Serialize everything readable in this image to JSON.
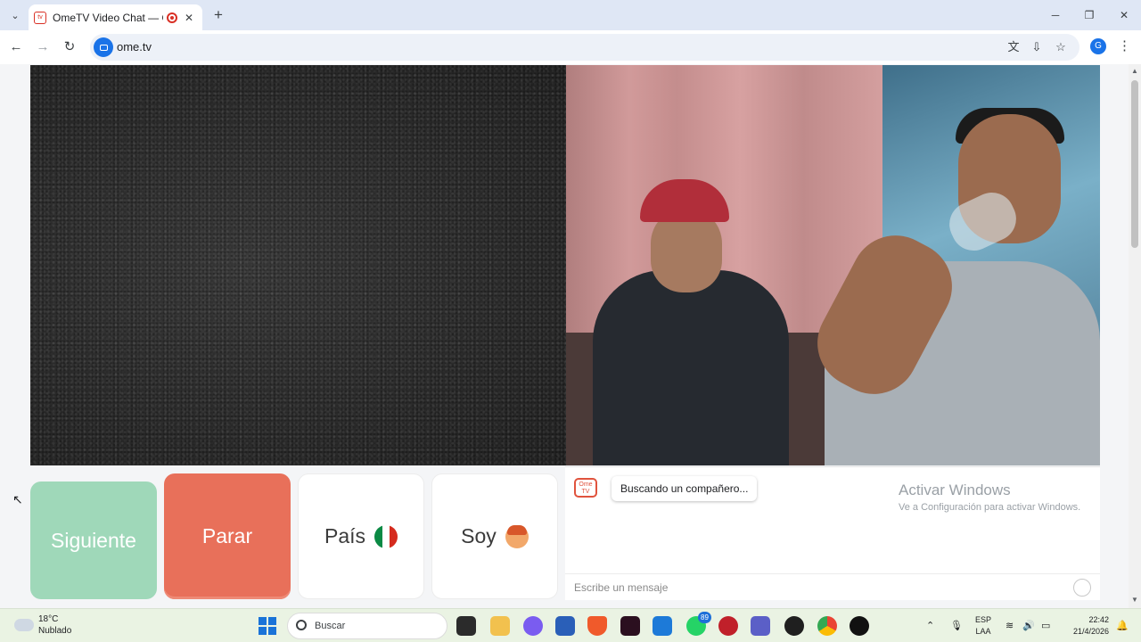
{
  "browser": {
    "tab_title": "OmeTV Video Chat — Ome",
    "tab_close": "✕",
    "new_tab": "+",
    "url": "ome.tv",
    "profile_initial": "G",
    "window_minimize": "─",
    "window_maximize": "❐",
    "window_close": "✕"
  },
  "controls": {
    "next_label": "Siguiente",
    "stop_label": "Parar",
    "country_label": "País",
    "gender_label": "Soy"
  },
  "chat": {
    "status_message": "Buscando un compañero...",
    "input_placeholder": "Escribe un mensaje",
    "logo_text": "Ome TV"
  },
  "watermark": {
    "title": "Activar Windows",
    "subtitle": "Ve a Configuración para activar Windows."
  },
  "taskbar": {
    "weather_temp": "18°C",
    "weather_desc": "Nublado",
    "search_placeholder": "Buscar",
    "whatsapp_badge": "89",
    "lang_line1": "ESP",
    "lang_line2": "LAA",
    "time": "22:42",
    "date": "21/4/2026"
  },
  "colors": {
    "next_button": "#9fd8b9",
    "stop_button": "#e8705a",
    "brand_red": "#e0533d",
    "browser_accent": "#1a73e8"
  }
}
